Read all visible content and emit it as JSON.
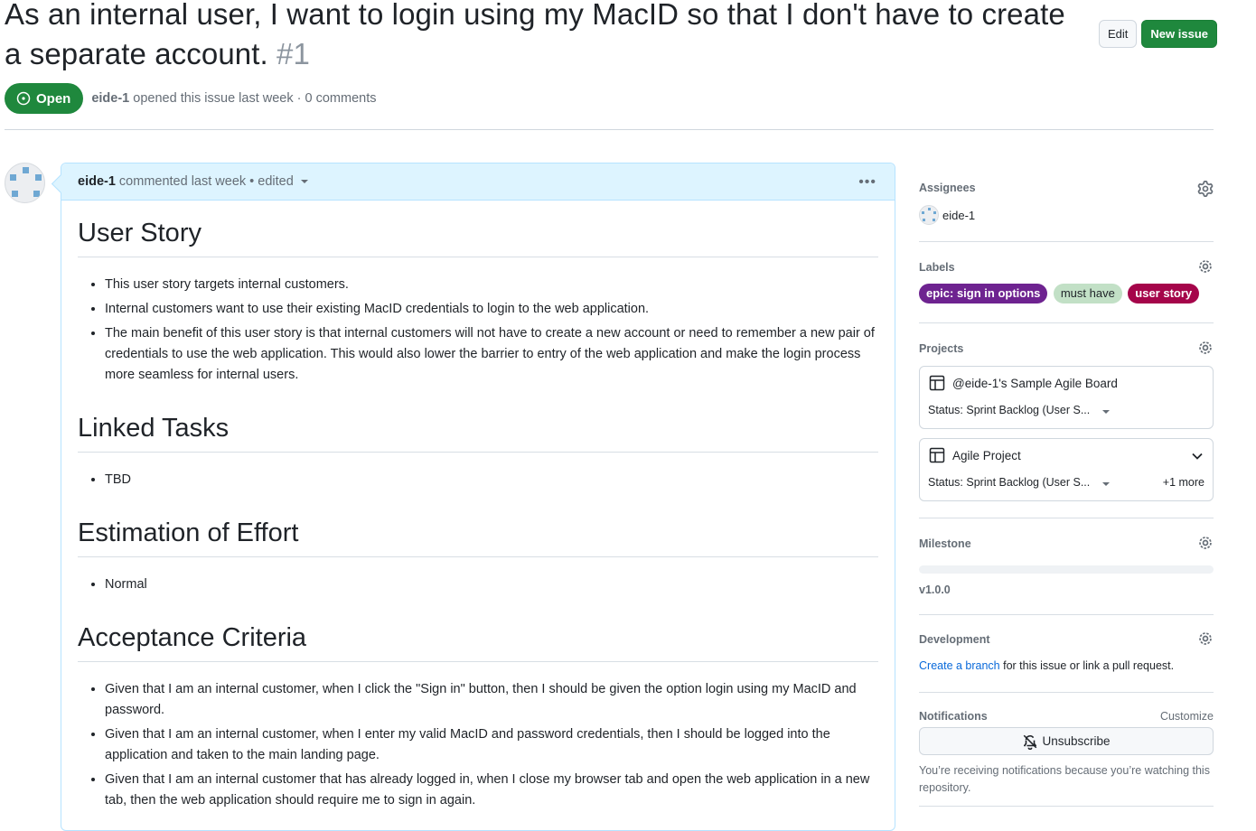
{
  "issue": {
    "title": "As an internal user, I want to login using my MacID so that I don't have to create a separate account.",
    "number": "#1",
    "state": "Open",
    "author": "eide-1",
    "meta_text": "opened this issue last week · 0 comments"
  },
  "header_actions": {
    "edit_label": "Edit",
    "new_issue_label": "New issue"
  },
  "comment": {
    "author": "eide-1",
    "meta": "commented last week • edited",
    "menu_icon": "kebab-horizontal-icon",
    "sections": [
      {
        "heading": "User Story",
        "items": [
          "This user story targets internal customers.",
          "Internal customers want to use their existing MacID credentials to login to the web application.",
          "The main benefit of this user story is that internal customers will not have to create a new account or need to remember a new pair of credentials to use the web application. This would also lower the barrier to entry of the web application and make the login process more seamless for internal users."
        ]
      },
      {
        "heading": "Linked Tasks",
        "items": [
          "TBD"
        ]
      },
      {
        "heading": "Estimation of Effort",
        "items": [
          "Normal"
        ]
      },
      {
        "heading": "Acceptance Criteria",
        "items": [
          "Given that I am an internal customer, when I click the \"Sign in\" button, then I should be given the option login using my MacID and password.",
          "Given that I am an internal customer, when I enter my valid MacID and password credentials, then I should be logged into the application and taken to the main landing page.",
          "Given that I am an internal customer that has already logged in, when I close my browser tab and open the web application in a new tab, then the web application should require me to sign in again."
        ]
      }
    ]
  },
  "sidebar": {
    "assignees": {
      "title": "Assignees",
      "users": [
        "eide-1"
      ]
    },
    "labels": {
      "title": "Labels",
      "items": [
        {
          "name": "epic: sign in options",
          "bg": "#6e2390",
          "fg": "#ffffff"
        },
        {
          "name": "must have",
          "bg": "#c2e0c6",
          "fg": "#1f2328"
        },
        {
          "name": "user story",
          "bg": "#a5054a",
          "fg": "#ffffff"
        }
      ]
    },
    "projects": {
      "title": "Projects",
      "items": [
        {
          "name": "@eide-1's Sample Agile Board",
          "status": "Status: Sprint Backlog (User S...",
          "more": ""
        },
        {
          "name": "Agile Project",
          "status": "Status: Sprint Backlog (User S...",
          "more": "+1 more"
        }
      ]
    },
    "milestone": {
      "title": "Milestone",
      "progress_percent": 0,
      "name": "v1.0.0"
    },
    "development": {
      "title": "Development",
      "link_text": "Create a branch",
      "rest_text": " for this issue or link a pull request."
    },
    "notifications": {
      "title": "Notifications",
      "customize_label": "Customize",
      "unsubscribe_label": "Unsubscribe",
      "reason": "You’re receiving notifications because you’re watching this repository."
    }
  },
  "colors": {
    "open_green": "#1f883d",
    "link_blue": "#0969da",
    "comment_header_bg": "#ddf4ff"
  }
}
